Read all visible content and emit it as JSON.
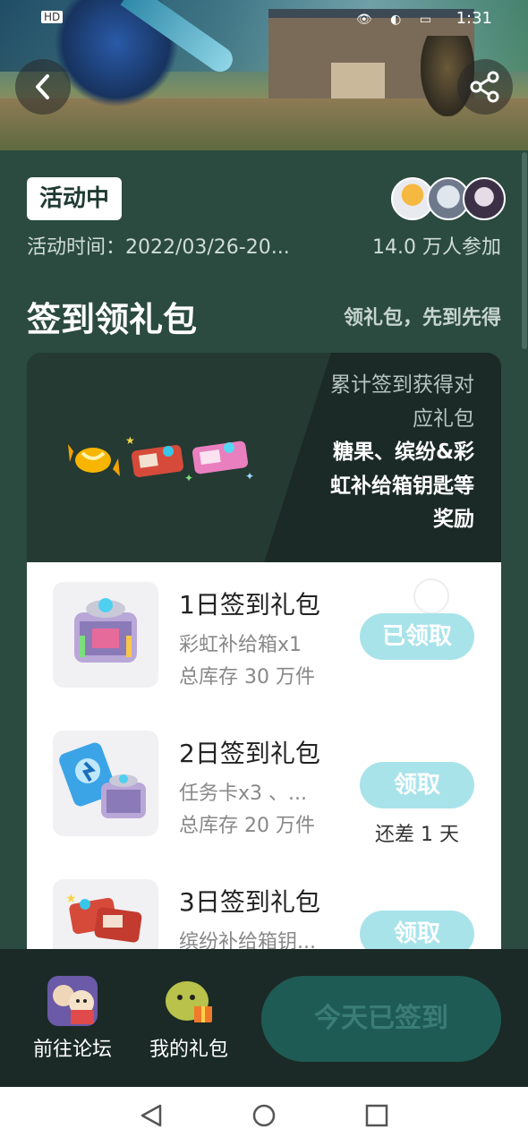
{
  "status_bar": {
    "hd": "HD",
    "time": "1:31"
  },
  "header": {
    "back_icon": "chevron-left-icon",
    "share_icon": "share-icon"
  },
  "activity": {
    "status_badge": "活动中",
    "time_label": "活动时间：2022/03/26-20...",
    "participants": "14.0 万人参加"
  },
  "section": {
    "title": "签到领礼包",
    "subtitle": "领礼包，先到先得"
  },
  "card": {
    "desc_line1": "累计签到获得对",
    "desc_line2": "应礼包",
    "desc_bold1": "糖果、缤纷&彩",
    "desc_bold2": "虹补给箱钥匙等",
    "desc_bold3": "奖励"
  },
  "gifts": [
    {
      "title": "1日签到礼包",
      "line1": "彩虹补给箱x1",
      "line2": "总库存 30 万件",
      "button": "已领取",
      "remain": ""
    },
    {
      "title": "2日签到礼包",
      "line1": "任务卡x3 、...",
      "line2": "总库存 20 万件",
      "button": "领取",
      "remain": "还差 1 天"
    },
    {
      "title": "3日签到礼包",
      "line1": "缤纷补给箱钥...",
      "line2": "",
      "button": "领取",
      "remain": ""
    }
  ],
  "bottom": {
    "forum_label": "前往论坛",
    "gifts_label": "我的礼包",
    "signed_button": "今天已签到"
  },
  "colors": {
    "bg": "#2b4a40",
    "accent": "#a9e3ea",
    "dark": "#1b2a26"
  }
}
